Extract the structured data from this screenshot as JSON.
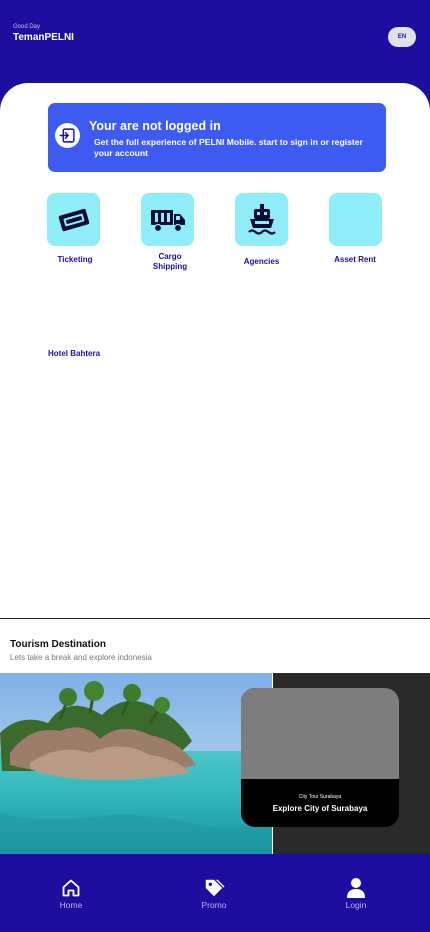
{
  "header": {
    "greeting": "Good Day",
    "brand": "TemanPELNI",
    "language": "EN"
  },
  "login_banner": {
    "title": "Your are not logged in",
    "subtitle": "Get the full experience of PELNI Mobile. start to sign in or register your account",
    "icon": "login-icon"
  },
  "menu": [
    {
      "label": "Ticketing",
      "icon": "ticket-icon"
    },
    {
      "label": "Cargo Shipping",
      "icon": "truck-icon"
    },
    {
      "label": "Agencies",
      "icon": "ship-icon"
    },
    {
      "label": "Asset Rent",
      "icon": ""
    }
  ],
  "hotel": {
    "label": "Hotel Bahtera"
  },
  "tourism": {
    "title": "Tourism Destination",
    "subtitle": "Lets take a break and explore indonesia",
    "card": {
      "kicker": "City Tour Surabaya",
      "title": "Explore City of Surabaya"
    }
  },
  "bottom_nav": [
    {
      "label": "Home",
      "icon": "home-icon"
    },
    {
      "label": "Promo",
      "icon": "tag-icon"
    },
    {
      "label": "Login",
      "icon": "user-icon"
    }
  ],
  "colors": {
    "primary": "#1c0fa0",
    "banner": "#3d5af1",
    "tile": "#8eedf7"
  }
}
